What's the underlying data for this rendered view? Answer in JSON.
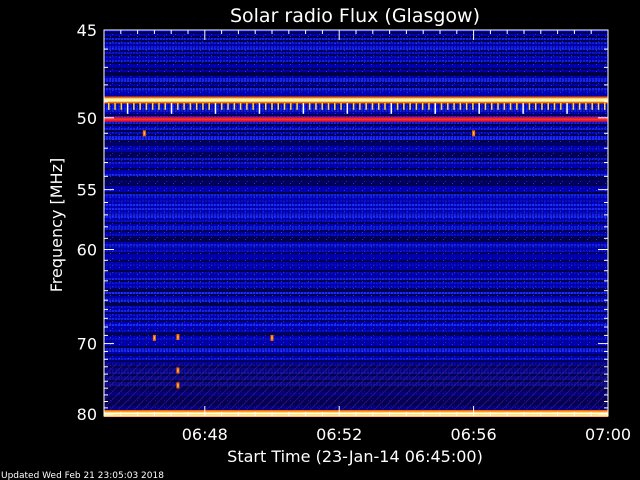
{
  "chart_data": {
    "type": "heatmap",
    "title": "Solar radio Flux (Glasgow)",
    "xlabel": "Start Time (23-Jan-14 06:45:00)",
    "ylabel": "Frequency [MHz]",
    "x_ticks": [
      "06:48",
      "06:52",
      "06:56",
      "07:00"
    ],
    "x_tick_minutes": [
      3,
      7,
      11,
      15
    ],
    "xlim_minutes": [
      0,
      15
    ],
    "y_ticks": [
      45,
      50,
      55,
      60,
      70,
      80
    ],
    "ylim": [
      80.3,
      45
    ],
    "y_scale": "reciprocal",
    "colormap": [
      "#00003a",
      "#0000a0",
      "#1a2cff",
      "#d01040",
      "#ff6a00",
      "#ffd64a",
      "#ffffff"
    ],
    "bands": [
      {
        "freq_mhz": 48.9,
        "level": "very-high"
      },
      {
        "freq_mhz": 50.1,
        "level": "high"
      },
      {
        "freq_mhz": 79.9,
        "level": "very-high"
      }
    ],
    "intermittent_band_mhz": 49.5,
    "bursts": [
      {
        "t_min": 1.2,
        "freq_mhz": 51.0
      },
      {
        "t_min": 11.0,
        "freq_mhz": 51.0
      },
      {
        "t_min": 1.5,
        "freq_mhz": 69.3
      },
      {
        "t_min": 2.2,
        "freq_mhz": 69.2
      },
      {
        "t_min": 5.0,
        "freq_mhz": 69.3
      },
      {
        "t_min": 2.2,
        "freq_mhz": 73.5
      },
      {
        "t_min": 2.2,
        "freq_mhz": 75.6
      }
    ]
  },
  "footer": {
    "updated": "Updated Wed Feb 21 23:05:03 2018"
  }
}
